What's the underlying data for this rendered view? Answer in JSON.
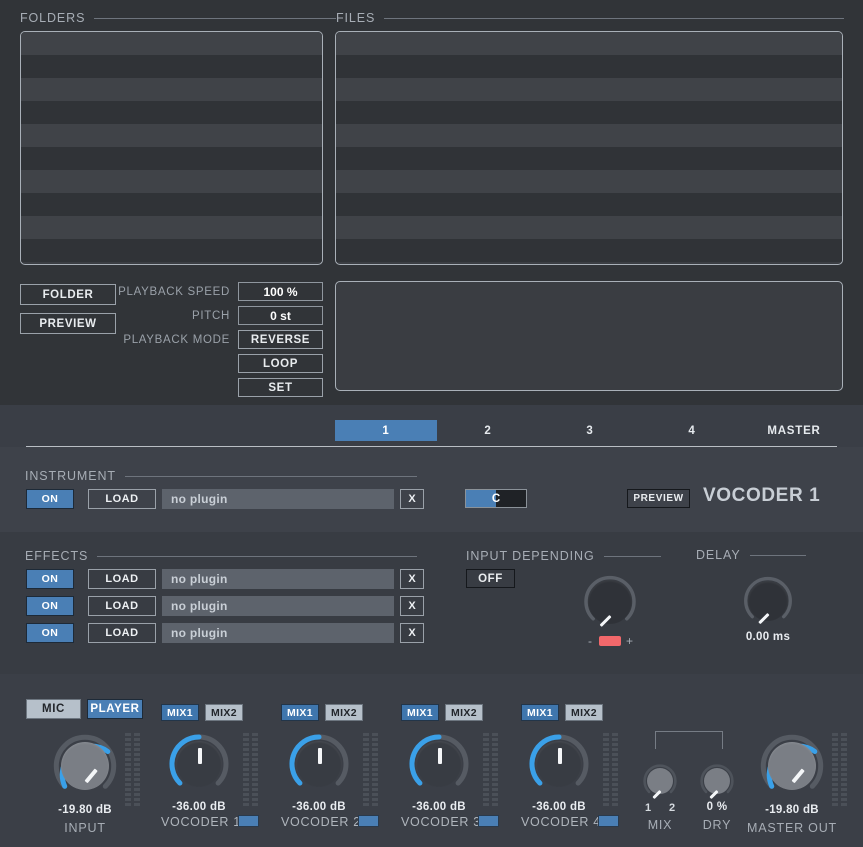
{
  "browser": {
    "folders_label": "FOLDERS",
    "files_label": "FILES",
    "folder_button": "FOLDER",
    "preview_button": "PREVIEW",
    "playback_speed_label": "PLAYBACK SPEED",
    "playback_speed_value": "100 %",
    "pitch_label": "PITCH",
    "pitch_value": "0 st",
    "playback_mode_label": "PLAYBACK  MODE",
    "mode_reverse": "REVERSE",
    "mode_loop": "LOOP",
    "mode_set": "SET"
  },
  "tabs": [
    {
      "label": "1",
      "active": true
    },
    {
      "label": "2",
      "active": false
    },
    {
      "label": "3",
      "active": false
    },
    {
      "label": "4",
      "active": false
    },
    {
      "label": "MASTER",
      "active": false
    }
  ],
  "instrument": {
    "header": "INSTRUMENT",
    "on_label": "ON",
    "load_label": "LOAD",
    "plugin_name": "no plugin",
    "clear_label": "X",
    "key_value": "C",
    "preview_label": "PREVIEW",
    "title": "VOCODER 1"
  },
  "effects": {
    "header": "EFFECTS",
    "slots": [
      {
        "on_label": "ON",
        "load_label": "LOAD",
        "plugin_name": "no plugin",
        "clear_label": "X"
      },
      {
        "on_label": "ON",
        "load_label": "LOAD",
        "plugin_name": "no plugin",
        "clear_label": "X"
      },
      {
        "on_label": "ON",
        "load_label": "LOAD",
        "plugin_name": "no plugin",
        "clear_label": "X"
      }
    ]
  },
  "input_depending": {
    "header": "INPUT DEPENDING",
    "state_label": "OFF",
    "minus": "-",
    "plus": "+"
  },
  "delay": {
    "header": "DELAY",
    "value": "0.00 ms"
  },
  "mixer": {
    "source": {
      "mic_label": "MIC",
      "player_label": "PLAYER",
      "active": "PLAYER"
    },
    "input": {
      "value": "-19.80 dB",
      "name": "INPUT"
    },
    "channels": [
      {
        "mix1": "MIX1",
        "mix2": "MIX2",
        "value": "-36.00 dB",
        "name": "VOCODER 1"
      },
      {
        "mix1": "MIX1",
        "mix2": "MIX2",
        "value": "-36.00 dB",
        "name": "VOCODER 2"
      },
      {
        "mix1": "MIX1",
        "mix2": "MIX2",
        "value": "-36.00 dB",
        "name": "VOCODER 3"
      },
      {
        "mix1": "MIX1",
        "mix2": "MIX2",
        "value": "-36.00 dB",
        "name": "VOCODER 4"
      }
    ],
    "mix": {
      "name": "MIX",
      "tick_1": "1",
      "tick_2": "2"
    },
    "dry": {
      "name": "DRY",
      "value": "0 %"
    },
    "master": {
      "name": "MASTER OUT",
      "value": "-19.80 dB"
    }
  },
  "colors": {
    "accent_blue": "#4a7fb5",
    "red_indicator": "#f2686b",
    "knob_arc": "#3aa0e8",
    "panel_bg": "#32353b"
  }
}
